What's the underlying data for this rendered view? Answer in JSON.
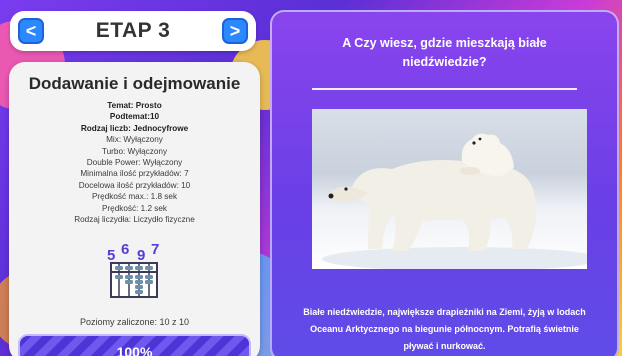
{
  "stage": {
    "prev_label": "<",
    "title": "ETAP 3",
    "next_label": ">"
  },
  "card": {
    "title": "Dodawanie i odejmowanie",
    "settings": {
      "topic": "Temat: Prosto",
      "subtopic": "Podtemat:10",
      "number_type": "Rodzaj liczb: Jednocyfrowe",
      "mix": "Mix: Wyłączony",
      "turbo": "Turbo: Wyłączony",
      "double_power": "Double Power: Wyłączony",
      "min_examples": "Minimalna ilość przykładów: 7",
      "target_examples": "Docelowa ilość przykładów: 10",
      "max_speed": "Prędkość max.: 1.8 sek",
      "speed": "Prędkość: 1.2 sek",
      "abacus_type": "Rodzaj liczydła: Liczydło fizyczne"
    },
    "abacus_digits": [
      "5",
      "6",
      "9",
      "7"
    ],
    "abacus_icon": "abacus-icon",
    "levels_completed": "Poziomy zaliczone: 10 z 10",
    "progress_label": "100%",
    "progress_fraction": 1.0
  },
  "fact": {
    "question": "A Czy wiesz, gdzie mieszkają białe niedźwiedzie?",
    "photo_icon": "polar-bear-photo",
    "text": "Białe niedźwiedzie, największe drapieżniki na Ziemi, żyją w lodach Oceanu Arktycznego na biegunie północnym. Potrafią świetnie pływać i nurkować."
  },
  "colors": {
    "accent_blue": "#2b88ff",
    "panel_purple": "#6a3fe6",
    "progress_purple": "#5a3fe0"
  }
}
